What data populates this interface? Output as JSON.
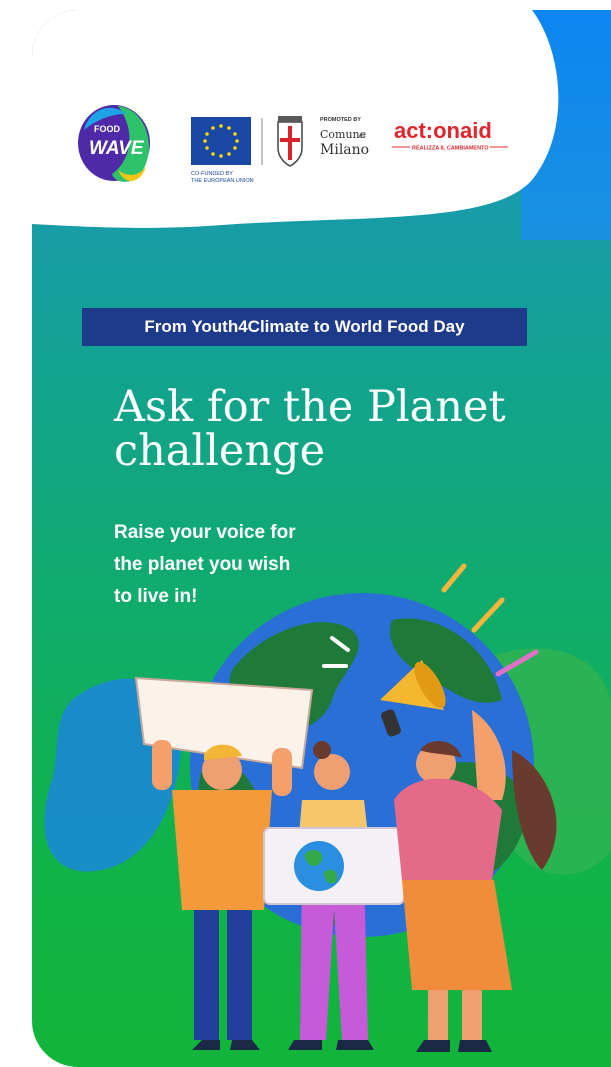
{
  "logos": {
    "food_wave": {
      "line1": "FOOD",
      "line2": "WAVE"
    },
    "eu": {
      "caption_line1": "CO-FUNDED BY",
      "caption_line2": "THE EUROPEAN UNION"
    },
    "milano": {
      "promoted": "PROMOTED BY",
      "comune": "Comune",
      "di": "di",
      "city": "Milano"
    },
    "actionaid": {
      "name": "act:onaid",
      "tagline": "REALIZZA IL CAMBIAMENTO"
    }
  },
  "badge": "From Youth4Climate to World Food Day",
  "title_line1": "Ask for the Planet",
  "title_line2": "challenge",
  "subtitle_line1": "Raise your voice for",
  "subtitle_line2": "the planet you wish",
  "subtitle_line3": "to live in!",
  "colors": {
    "navy": "#1e3a8a",
    "actionaid_red": "#e0262c",
    "eu_blue": "#1a47a6",
    "eu_star": "#f5d90a"
  }
}
